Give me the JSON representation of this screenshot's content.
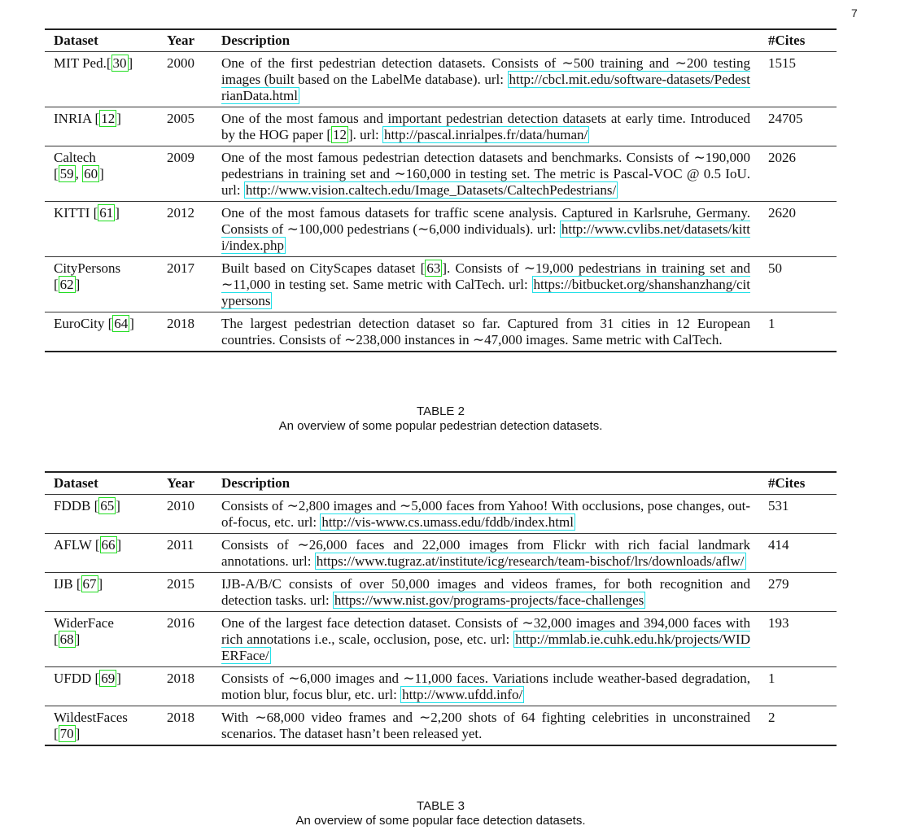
{
  "page_number": "7",
  "tables": [
    {
      "columns": [
        "Dataset",
        "Year",
        "Description",
        "#Cites"
      ],
      "caption_title": "TABLE 2",
      "caption_text": "An overview of some popular pedestrian detection datasets.",
      "rows": [
        {
          "name": "MIT Ped.",
          "name_cites": [
            "30"
          ],
          "name_break": false,
          "year": "2000",
          "cites": "1515",
          "desc": [
            {
              "t": "text",
              "v": "One of the first pedestrian detection datasets. Consists of ∼500 training and ∼200 testing images (built based on the LabelMe database). url: "
            },
            {
              "t": "url",
              "v": "http://cbcl.mit.edu/software-datasets/PedestrianData.html"
            }
          ]
        },
        {
          "name": "INRIA",
          "name_cites": [
            "12"
          ],
          "name_break": false,
          "year": "2005",
          "cites": "24705",
          "desc": [
            {
              "t": "text",
              "v": "One of the most famous and important pedestrian detection datasets at early time. Introduced by the HOG paper ["
            },
            {
              "t": "cite",
              "v": "12"
            },
            {
              "t": "text",
              "v": "]. url: "
            },
            {
              "t": "url",
              "v": "http://pascal.inrialpes.fr/data/human/"
            }
          ]
        },
        {
          "name": "Caltech",
          "name_cites": [
            "59",
            "60"
          ],
          "name_break": true,
          "year": "2009",
          "cites": "2026",
          "desc": [
            {
              "t": "text",
              "v": "One of the most famous pedestrian detection datasets and benchmarks. Consists of ∼190,000 pedestrians in training set and ∼160,000 in testing set. The metric is Pascal-VOC @ 0.5 IoU. url: "
            },
            {
              "t": "url",
              "v": "http://www.vision.caltech.edu/Image_Datasets/CaltechPedestrians/"
            }
          ]
        },
        {
          "name": "KITTI",
          "name_cites": [
            "61"
          ],
          "name_break": false,
          "year": "2012",
          "cites": "2620",
          "desc": [
            {
              "t": "text",
              "v": "One of the most famous datasets for traffic scene analysis. Captured in Karlsruhe, Germany. Consists of ∼100,000 pedestrians (∼6,000 individuals). url: "
            },
            {
              "t": "url",
              "v": "http://www.cvlibs.net/datasets/kitti/index.php"
            }
          ]
        },
        {
          "name": "CityPersons",
          "name_cites": [
            "62"
          ],
          "name_break": true,
          "year": "2017",
          "cites": "50",
          "desc": [
            {
              "t": "text",
              "v": "Built based on CityScapes dataset ["
            },
            {
              "t": "cite",
              "v": "63"
            },
            {
              "t": "text",
              "v": "]. Consists of ∼19,000 pedestrians in training set and ∼11,000 in testing set. Same metric with CalTech. url: "
            },
            {
              "t": "url",
              "v": "https://bitbucket.org/shanshanzhang/citypersons"
            }
          ]
        },
        {
          "name": "EuroCity",
          "name_cites": [
            "64"
          ],
          "name_break": false,
          "year": "2018",
          "cites": "1",
          "desc": [
            {
              "t": "text",
              "v": "The largest pedestrian detection dataset so far. Captured from 31 cities in 12 European countries. Consists of ∼238,000 instances in ∼47,000 images. Same metric with CalTech."
            }
          ]
        }
      ]
    },
    {
      "columns": [
        "Dataset",
        "Year",
        "Description",
        "#Cites"
      ],
      "caption_title": "TABLE 3",
      "caption_text": "An overview of some popular face detection datasets.",
      "rows": [
        {
          "name": "FDDB",
          "name_cites": [
            "65"
          ],
          "name_break": false,
          "year": "2010",
          "cites": "531",
          "desc": [
            {
              "t": "text",
              "v": "Consists of ∼2,800 images and ∼5,000 faces from Yahoo! With occlusions, pose changes, out-of-focus, etc. url: "
            },
            {
              "t": "url",
              "v": "http://vis-www.cs.umass.edu/fddb/index.html"
            }
          ]
        },
        {
          "name": "AFLW",
          "name_cites": [
            "66"
          ],
          "name_break": false,
          "year": "2011",
          "cites": "414",
          "desc": [
            {
              "t": "text",
              "v": "Consists of ∼26,000 faces and 22,000 images from Flickr with rich facial landmark annotations. url: "
            },
            {
              "t": "url",
              "v": "https://www.tugraz.at/institute/icg/research/team-bischof/lrs/downloads/aflw/"
            }
          ]
        },
        {
          "name": "IJB",
          "name_cites": [
            "67"
          ],
          "name_break": false,
          "year": "2015",
          "cites": "279",
          "desc": [
            {
              "t": "text",
              "v": "IJB-A/B/C consists of over 50,000 images and videos frames, for both recognition and detection tasks. url: "
            },
            {
              "t": "url",
              "v": "https://www.nist.gov/programs-projects/face-challenges"
            }
          ]
        },
        {
          "name": "WiderFace",
          "name_cites": [
            "68"
          ],
          "name_break": true,
          "year": "2016",
          "cites": "193",
          "desc": [
            {
              "t": "text",
              "v": "One of the largest face detection dataset. Consists of ∼32,000 images and 394,000 faces with rich annotations i.e., scale, occlusion, pose, etc. url: "
            },
            {
              "t": "url",
              "v": "http://mmlab.ie.cuhk.edu.hk/projects/WIDERFace/"
            }
          ]
        },
        {
          "name": "UFDD",
          "name_cites": [
            "69"
          ],
          "name_break": false,
          "year": "2018",
          "cites": "1",
          "desc": [
            {
              "t": "text",
              "v": "Consists of ∼6,000 images and ∼11,000 faces. Variations include weather-based degradation, motion blur, focus blur, etc. url: "
            },
            {
              "t": "url",
              "v": "http://www.ufdd.info/"
            }
          ]
        },
        {
          "name": "WildestFaces",
          "name_cites": [
            "70"
          ],
          "name_break": true,
          "year": "2018",
          "cites": "2",
          "desc": [
            {
              "t": "text",
              "v": "With ∼68,000 video frames and ∼2,200 shots of 64 fighting celebrities in unconstrained scenarios. The dataset hasn’t been released yet."
            }
          ]
        }
      ]
    }
  ]
}
